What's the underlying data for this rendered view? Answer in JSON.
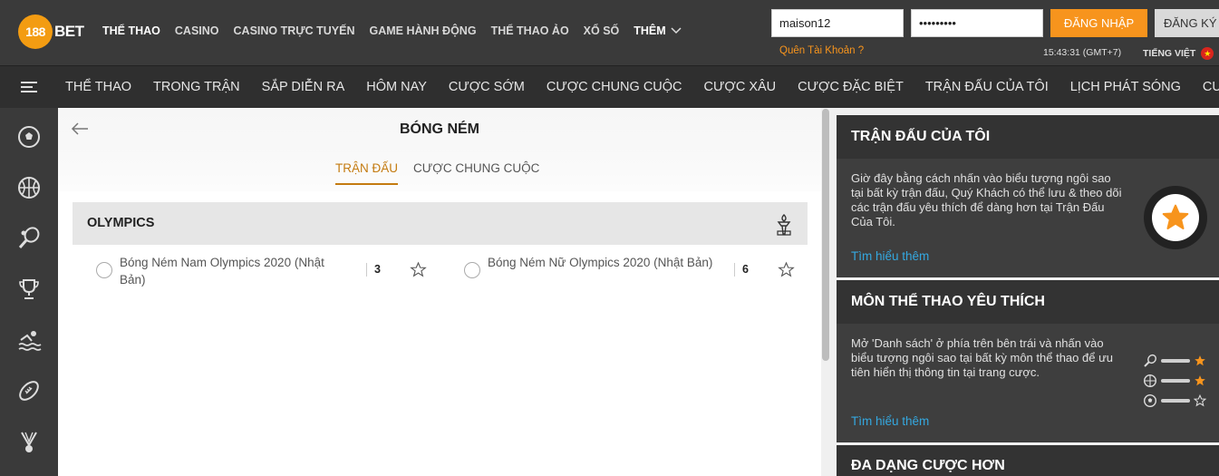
{
  "header": {
    "logo_number": "188",
    "logo_text": "BET",
    "nav": [
      "THỂ THAO",
      "CASINO",
      "CASINO TRỰC TUYẾN",
      "GAME HÀNH ĐỘNG",
      "THỂ THAO ẢO",
      "XỔ SỐ"
    ],
    "more_label": "THÊM",
    "username_value": "maison12",
    "password_value": "•••••••••",
    "login_label": "ĐĂNG NHẬP",
    "register_label": "ĐĂNG KÝ",
    "forgot_label": "Quên Tài Khoản ?",
    "clock": "15:43:31 (GMT+7)",
    "language": "TIẾNG VIỆT"
  },
  "subnav": [
    "THỂ THAO",
    "TRONG TRẬN",
    "SẮP DIỄN RA",
    "HÔM NAY",
    "CƯỢC SỚM",
    "CƯỢC CHUNG CUỘC",
    "CƯỢC XÂU",
    "CƯỢC ĐẶC BIỆT",
    "TRẬN ĐẤU CỦA TÔI",
    "LỊCH PHÁT SÓNG",
    "CƯỢC"
  ],
  "sidebar_icons": [
    "soccer-icon",
    "basketball-icon",
    "tennis-icon",
    "trophy-icon",
    "swimming-icon",
    "football-icon",
    "badminton-icon"
  ],
  "main": {
    "title": "BÓNG NÉM",
    "tabs": [
      "TRẬN ĐẤU",
      "CƯỢC CHUNG CUỘC"
    ],
    "group_title": "OLYMPICS",
    "competitions": [
      {
        "name": "Bóng Ném Nam Olympics 2020 (Nhật Bản)",
        "count": "3"
      },
      {
        "name": "Bóng Ném Nữ Olympics 2020 (Nhật Bản)",
        "count": "6"
      }
    ]
  },
  "widgets": {
    "my_matches": {
      "title": "TRẬN ĐẤU CỦA TÔI",
      "text": "Giờ đây bằng cách nhấn vào biểu tượng ngôi sao tại bất kỳ trận đấu, Quý Khách có thể lưu & theo dõi các trận đấu yêu thích để dàng hơn tại Trận Đấu Của Tôi.",
      "learn_more": "Tìm hiểu thêm"
    },
    "favorite_sports": {
      "title": "MÔN THỂ THAO YÊU THÍCH",
      "text": "Mở 'Danh sách' ở phía trên bên trái và nhấn vào biểu tượng ngôi sao tại bất kỳ môn thể thao để ưu tiên hiển thị thông tin tại trang cược.",
      "learn_more": "Tìm hiểu thêm"
    },
    "more_bets": {
      "title": "ĐA DẠNG CƯỢC HƠN"
    }
  },
  "colors": {
    "accent": "#f7941d",
    "tab_active": "#c47b10",
    "link": "#34a8e0"
  }
}
